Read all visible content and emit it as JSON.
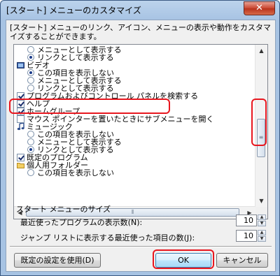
{
  "window": {
    "title": "[スタート] メニューのカスタマイズ",
    "close_glyph": "✕"
  },
  "description": "[スタート] メニューのリンク、アイコン、メニューの表示や動作をカスタマイズすることができます。",
  "options": [
    {
      "kind": "radio",
      "label": "メニューとして表示する",
      "checked": false,
      "indent": 1
    },
    {
      "kind": "radio",
      "label": "リンクとして表示する",
      "checked": true,
      "indent": 1
    },
    {
      "kind": "header",
      "label": "ビデオ",
      "icon": "video-icon"
    },
    {
      "kind": "radio",
      "label": "この項目を表示しない",
      "checked": true,
      "indent": 1
    },
    {
      "kind": "radio",
      "label": "メニューとして表示する",
      "checked": false,
      "indent": 1
    },
    {
      "kind": "radio",
      "label": "リンクとして表示する",
      "checked": false,
      "indent": 1
    },
    {
      "kind": "checkbox",
      "label": "プログラムおよびコントロール パネルを検索する",
      "checked": true
    },
    {
      "kind": "checkbox",
      "label": "ヘルプ",
      "checked": true
    },
    {
      "kind": "checkbox",
      "label": "ホームグループ",
      "checked": true
    },
    {
      "kind": "checkbox",
      "label": "マウス ポインターを置いたときにサブメニューを開く",
      "checked": false
    },
    {
      "kind": "header",
      "label": "ミュージック",
      "icon": "music-icon"
    },
    {
      "kind": "radio",
      "label": "この項目を表示しない",
      "checked": false,
      "indent": 1
    },
    {
      "kind": "radio",
      "label": "メニューとして表示する",
      "checked": false,
      "indent": 1
    },
    {
      "kind": "radio",
      "label": "リンクとして表示する",
      "checked": true,
      "indent": 1
    },
    {
      "kind": "checkbox",
      "label": "既定のプログラム",
      "checked": true
    },
    {
      "kind": "header",
      "label": "個人用フォルダー",
      "icon": "folder-icon"
    },
    {
      "kind": "radio",
      "label": "この項目を表示しない",
      "checked": false,
      "indent": 1
    }
  ],
  "size_group": {
    "title": "スタート メニューのサイズ",
    "recent_programs_label": "最近使ったプログラムの表示数(N):",
    "recent_programs_value": "10",
    "jump_list_label": "ジャンプ リストに表示する最近使った項目の数(J):",
    "jump_list_value": "10"
  },
  "buttons": {
    "defaults": "既定の設定を使用(D)",
    "ok": "OK",
    "cancel": "キャンセル"
  },
  "highlight_color": "#e8171f"
}
